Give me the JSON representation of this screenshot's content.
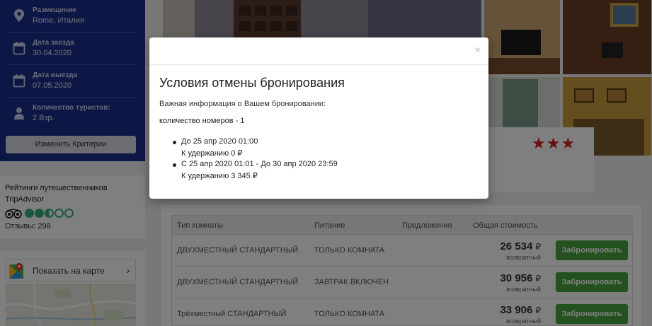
{
  "search": {
    "criteria": [
      {
        "icon": "location-pin-icon",
        "label": "Размещение",
        "value": "Rome, Италия"
      },
      {
        "icon": "calendar-icon",
        "label": "Дата заезда",
        "value": "30.04.2020"
      },
      {
        "icon": "calendar-icon",
        "label": "Дата выезда",
        "value": "07.05.2020"
      },
      {
        "icon": "person-icon",
        "label": "Количество туристов:",
        "value": "2 Взр."
      }
    ],
    "change_label": "Изменить Критерии"
  },
  "ratings": {
    "title_line1": "Рейтинги путешественников",
    "title_line2": "TripAdvisor",
    "bubble_rating": 2.5,
    "reviews": "Отзывы: 298"
  },
  "map": {
    "link_label": "Показать на карте"
  },
  "hotel": {
    "stars": 3
  },
  "rooms_table": {
    "headers": {
      "room_type": "Тип комнаты",
      "meal": "Питание",
      "offers": "Предложения",
      "total": "Общая стоимость"
    },
    "rows": [
      {
        "room_type": "ДВУХМЕСТНЫЙ СТАНДАРТНЫЙ",
        "meal": "ТОЛЬКО КОМНАТА",
        "price": "26 534",
        "currency": "₽",
        "refund": "возвратный",
        "book": "Забронировать"
      },
      {
        "room_type": "ДВУХМЕСТНЫЙ СТАНДАРТНЫЙ",
        "meal": "ЗАВТРАК ВКЛЮЧЕН",
        "price": "30 956",
        "currency": "₽",
        "refund": "возвратный",
        "book": "Забронировать"
      },
      {
        "room_type": "Трёхместный СТАНДАРТНЫЙ",
        "meal": "ТОЛЬКО КОМНАТА",
        "price": "33 906",
        "currency": "₽",
        "refund": "возвратный",
        "book": "Забронировать"
      }
    ]
  },
  "modal": {
    "close": "×",
    "title": "Условия отмены бронирования",
    "info": "Важная информация о Вашем бронировании:",
    "rooms_count": "количество номеров - 1",
    "policies": [
      {
        "period": "До 25 апр 2020 01:00",
        "retention": "К удержанию 0 ₽"
      },
      {
        "period": "С 25 апр 2020 01:01 - До 30 апр 2020 23:59",
        "retention": "К удержанию 3 345 ₽"
      }
    ]
  },
  "colors": {
    "search_panel": "#1a2f8a",
    "book_button": "#46a340",
    "star": "#d21e1e",
    "tripadvisor": "#34b07a"
  }
}
